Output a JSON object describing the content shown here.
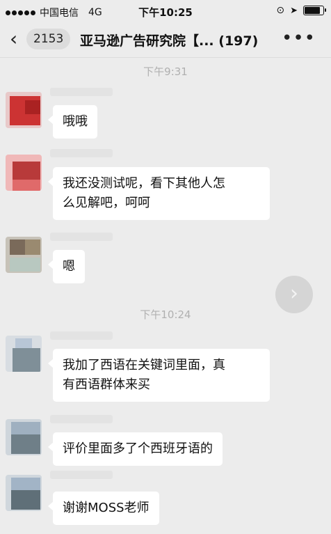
{
  "status_bar": {
    "carrier": "中国电信",
    "network": "4G",
    "time": "下午10:25"
  },
  "nav": {
    "unread_count": "2153",
    "title": "亚马逊广告研究院【... (197)",
    "back_icon": "chevron-left-icon",
    "more_icon": "more-dots-icon"
  },
  "messages": {
    "ts1": "下午9:31",
    "m1": "哦哦",
    "m2_line1": "我还没测试呢，看下其他人怎",
    "m2_line2": "么见解吧，呵呵",
    "m3": "嗯",
    "ts2": "下午10:24",
    "m4_line1": "我加了西语在关键词里面，真",
    "m4_line2": "有西语群体来买",
    "m5": "评价里面多了个西班牙语的",
    "m6": "谢谢MOSS老师"
  }
}
